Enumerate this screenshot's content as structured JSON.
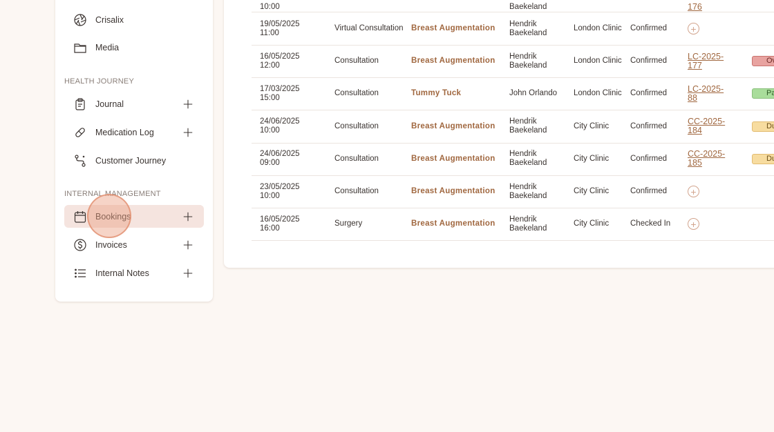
{
  "sidebar": {
    "items_top": [
      {
        "label": "Crisalix",
        "icon": "aperture-icon"
      },
      {
        "label": "Media",
        "icon": "folder-icon"
      }
    ],
    "health_journey": {
      "title": "HEALTH JOURNEY",
      "items": [
        {
          "label": "Journal",
          "icon": "clipboard-icon",
          "has_add": true
        },
        {
          "label": "Medication Log",
          "icon": "pill-icon",
          "has_add": true
        },
        {
          "label": "Customer Journey",
          "icon": "route-icon",
          "has_add": false
        }
      ]
    },
    "internal_management": {
      "title": "INTERNAL MANAGEMENT",
      "items": [
        {
          "label": "Bookings",
          "icon": "calendar-icon",
          "has_add": true,
          "active": true
        },
        {
          "label": "Invoices",
          "icon": "dollar-circle-icon",
          "has_add": true
        },
        {
          "label": "Internal Notes",
          "icon": "list-icon",
          "has_add": true
        }
      ]
    }
  },
  "table": {
    "partial_row": {
      "date": "10:00",
      "doctor": "Baekeland",
      "invoice": "176"
    },
    "rows": [
      {
        "date": "19/05/2025",
        "time": "11:00",
        "type": "Virtual Consultation",
        "procedure": "Breast Augmentation",
        "doctor": "Hendrik Baekeland",
        "clinic": "London Clinic",
        "status": "Confirmed",
        "invoice": null,
        "payment": null
      },
      {
        "date": "16/05/2025",
        "time": "12:00",
        "type": "Consultation",
        "procedure": "Breast Augmentation",
        "doctor": "Hendrik Baekeland",
        "clinic": "London Clinic",
        "status": "Confirmed",
        "invoice": "LC-2025-177",
        "invoice_l1": "LC-2025-",
        "invoice_l2": "177",
        "payment": "Over",
        "payment_kind": "overdue"
      },
      {
        "date": "17/03/2025",
        "time": "15:00",
        "type": "Consultation",
        "procedure": "Tummy Tuck",
        "doctor": "John Orlando",
        "clinic": "London Clinic",
        "status": "Confirmed",
        "invoice": "LC-2025-88",
        "invoice_l1": "LC-2025-",
        "invoice_l2": "88",
        "payment": "Pa",
        "payment_kind": "paid"
      },
      {
        "date": "24/06/2025",
        "time": "10:00",
        "type": "Consultation",
        "procedure": "Breast Augmentation",
        "doctor": "Hendrik Baekeland",
        "clinic": "City Clinic",
        "status": "Confirmed",
        "invoice": "CC-2025-184",
        "invoice_l1": "CC-2025-",
        "invoice_l2": "184",
        "payment": "Du",
        "payment_kind": "due"
      },
      {
        "date": "24/06/2025",
        "time": "09:00",
        "type": "Consultation",
        "procedure": "Breast Augmentation",
        "doctor": "Hendrik Baekeland",
        "clinic": "City Clinic",
        "status": "Confirmed",
        "invoice": "CC-2025-185",
        "invoice_l1": "CC-2025-",
        "invoice_l2": "185",
        "payment": "Du",
        "payment_kind": "due"
      },
      {
        "date": "23/05/2025",
        "time": "10:00",
        "type": "Consultation",
        "procedure": "Breast Augmentation",
        "doctor": "Hendrik Baekeland",
        "clinic": "City Clinic",
        "status": "Confirmed",
        "invoice": null,
        "payment": null
      },
      {
        "date": "16/05/2025",
        "time": "16:00",
        "type": "Surgery",
        "procedure": "Breast Augmentation",
        "doctor": "Hendrik Baekeland",
        "clinic": "City Clinic",
        "status": "Checked In",
        "invoice": null,
        "payment": null
      }
    ]
  },
  "colors": {
    "background": "#fcf7f3",
    "accent": "#a0673f",
    "active_nav": "#f5e4df"
  }
}
